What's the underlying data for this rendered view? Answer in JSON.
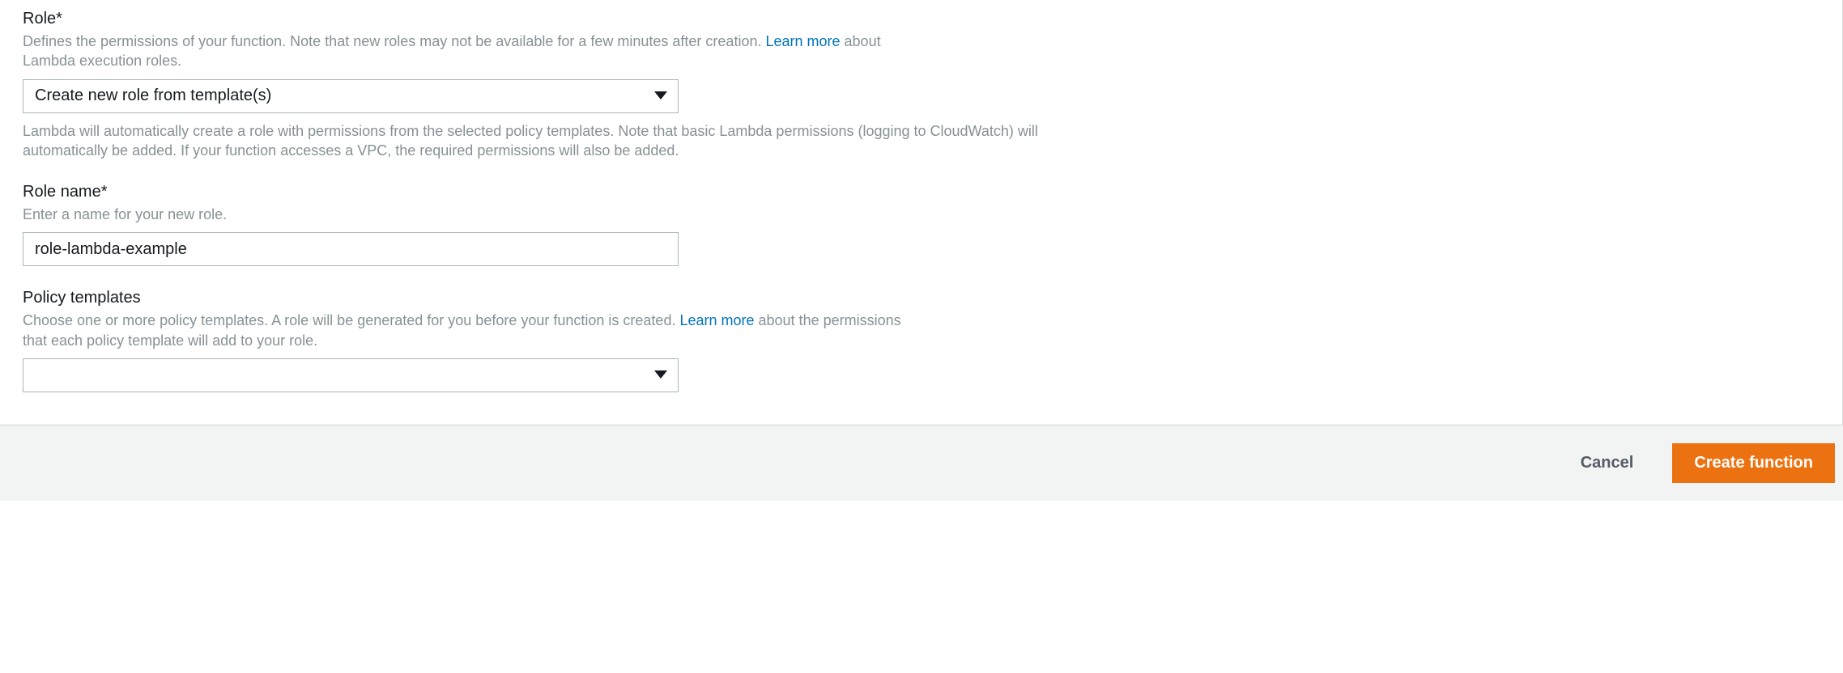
{
  "role": {
    "label": "Role*",
    "desc_before": "Defines the permissions of your function. Note that new roles may not be available for a few minutes after creation. ",
    "learn_more": "Learn more",
    "desc_after": " about Lambda execution roles.",
    "selected": "Create new role from template(s)",
    "help": "Lambda will automatically create a role with permissions from the selected policy templates. Note that basic Lambda permissions (logging to CloudWatch) will automatically be added. If your function accesses a VPC, the required permissions will also be added."
  },
  "role_name": {
    "label": "Role name*",
    "desc": "Enter a name for your new role.",
    "value": "role-lambda-example"
  },
  "policy_templates": {
    "label": "Policy templates",
    "desc_before": "Choose one or more policy templates. A role will be generated for you before your function is created. ",
    "learn_more": "Learn more",
    "desc_after": " about the permissions that each policy template will add to your role.",
    "selected": ""
  },
  "footer": {
    "cancel": "Cancel",
    "create": "Create function"
  }
}
